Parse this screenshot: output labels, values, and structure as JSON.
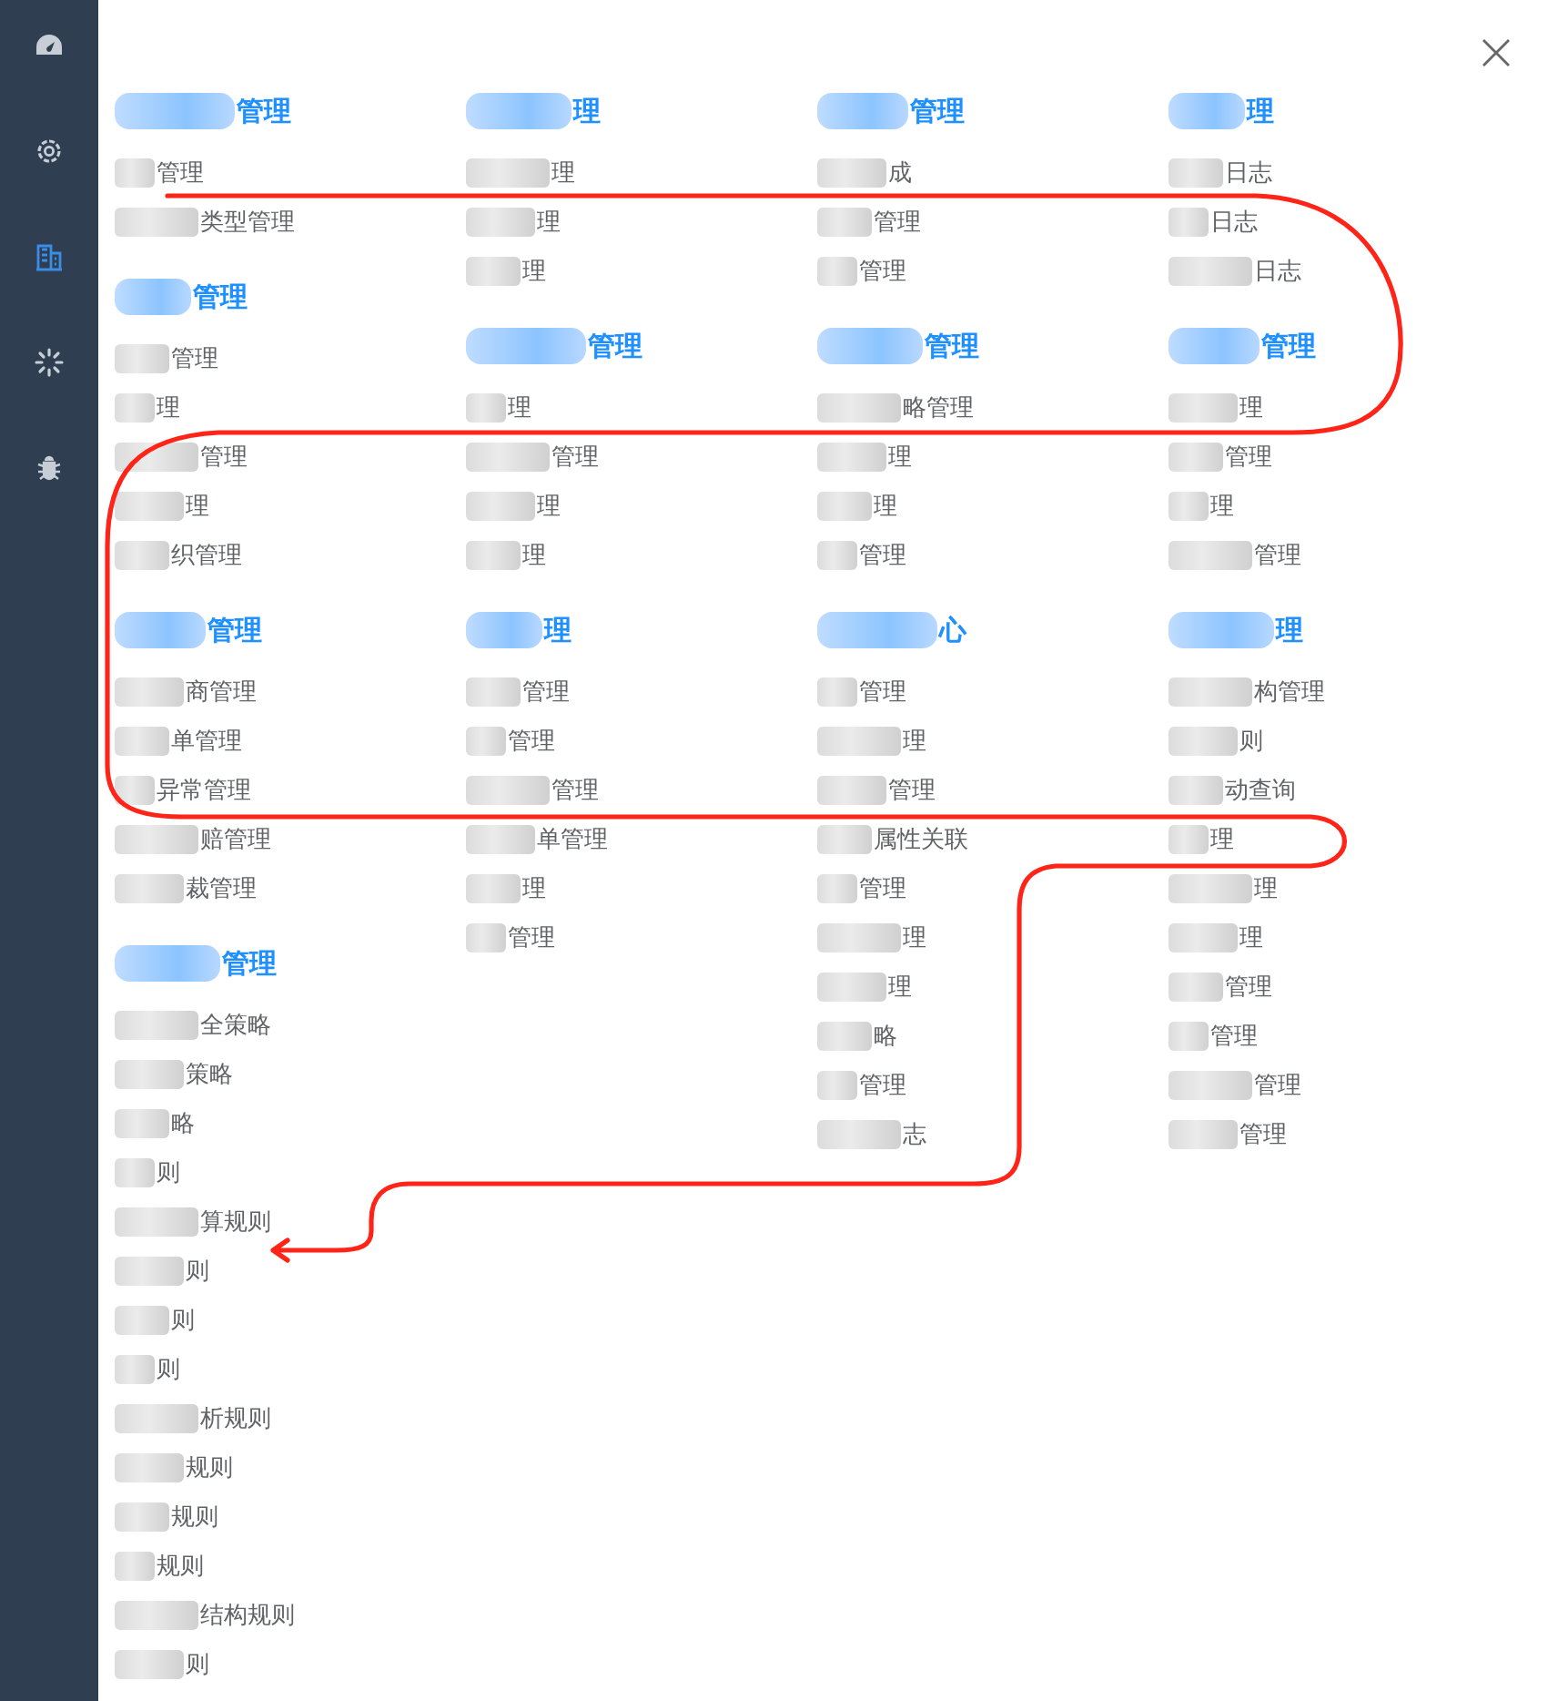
{
  "sidebar": {
    "items": [
      {
        "selected": false
      },
      {
        "selected": false
      },
      {
        "selected": true
      },
      {
        "selected": false
      },
      {
        "selected": false
      }
    ]
  },
  "columns": [
    {
      "sections": [
        {
          "title": "管理",
          "items": [
            "管理",
            "类型管理"
          ]
        },
        {
          "title": "管理",
          "items": [
            "管理",
            "理",
            "管理",
            "理",
            "织管理"
          ]
        },
        {
          "title": "管理",
          "items": [
            "商管理",
            "单管理",
            "异常管理",
            "赔管理",
            "裁管理"
          ]
        },
        {
          "title": "管理",
          "items": [
            "全策略",
            "策略",
            "略",
            "则",
            "算规则",
            "则",
            "则",
            "则",
            "析规则",
            "规则",
            "规则",
            "规则",
            "结构规则",
            "则"
          ]
        }
      ]
    },
    {
      "sections": [
        {
          "title": "理",
          "items": [
            "理",
            "理",
            "理"
          ]
        },
        {
          "title": "管理",
          "items": [
            "理",
            "管理",
            "理",
            "理"
          ]
        },
        {
          "title": "理",
          "items": [
            "管理",
            "管理",
            "管理",
            "单管理",
            "理",
            "管理"
          ]
        }
      ]
    },
    {
      "sections": [
        {
          "title": "管理",
          "items": [
            "成",
            "管理",
            "管理"
          ]
        },
        {
          "title": "管理",
          "items": [
            "略管理",
            "理",
            "理",
            "管理"
          ]
        },
        {
          "title": "心",
          "items": [
            "管理",
            "理",
            "管理",
            "属性关联",
            "管理",
            "理",
            "理",
            "略",
            "管理",
            "志"
          ]
        }
      ]
    },
    {
      "sections": [
        {
          "title": "理",
          "items": [
            "日志",
            "日志",
            "日志"
          ]
        },
        {
          "title": "管理",
          "items": [
            "理",
            "管理",
            "理",
            "管理"
          ]
        },
        {
          "title": "理",
          "items": [
            "构管理",
            "则",
            "动查询",
            "理",
            "理",
            "理",
            "管理",
            "管理",
            "管理",
            "管理"
          ]
        }
      ]
    }
  ]
}
